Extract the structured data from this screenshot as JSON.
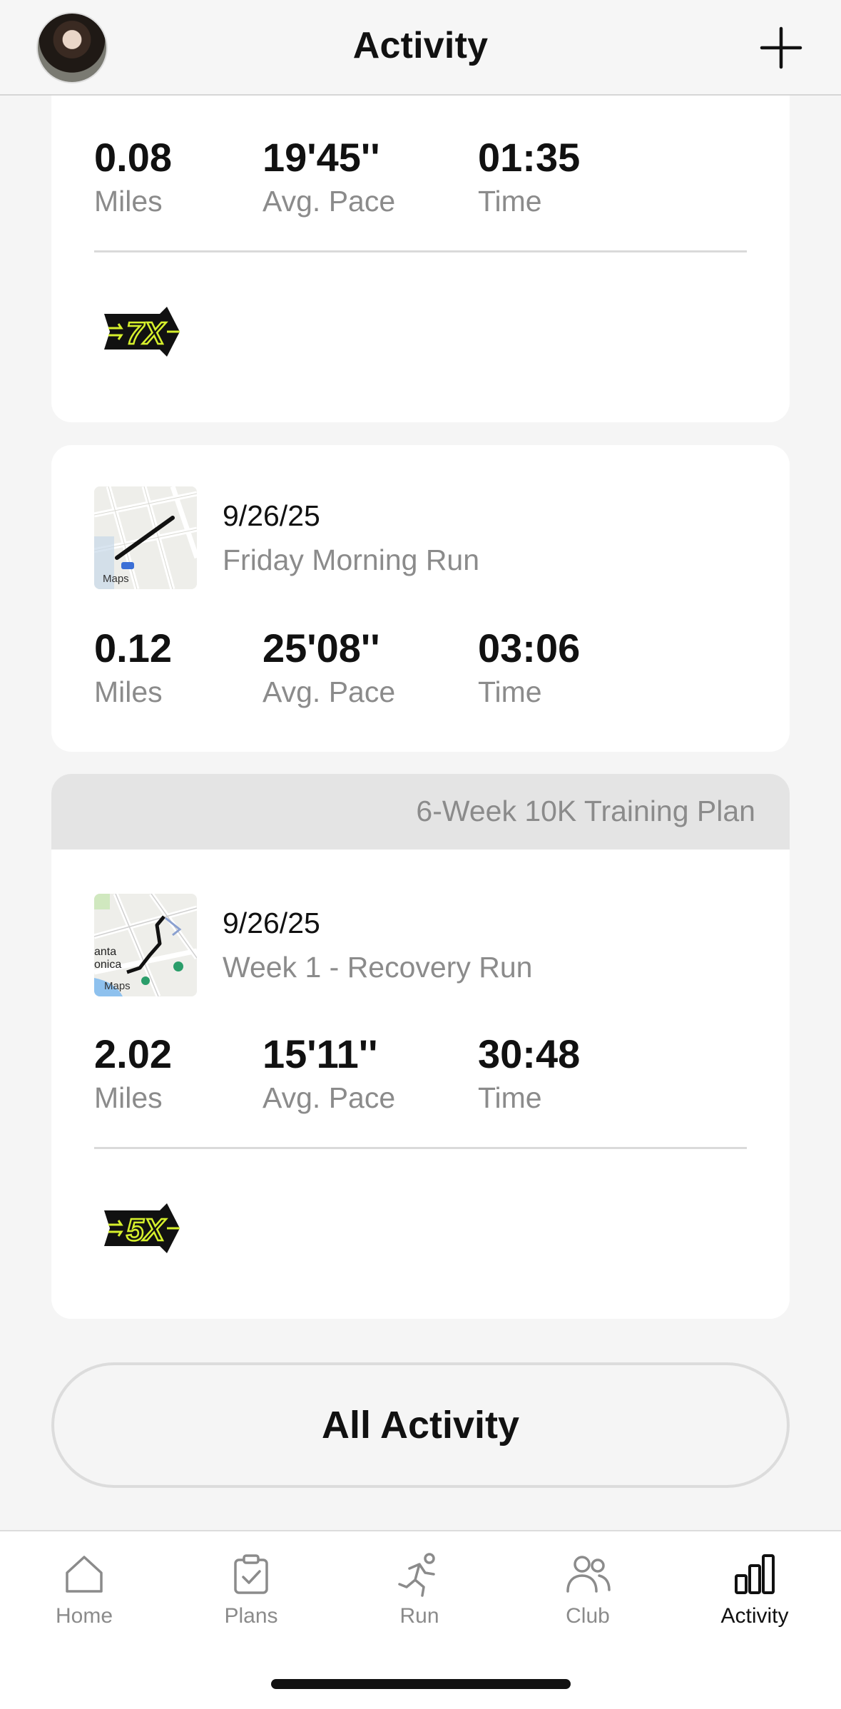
{
  "header": {
    "title": "Activity"
  },
  "runs": [
    {
      "stats": [
        {
          "value": "0.08",
          "label": "Miles"
        },
        {
          "value": "19'45''",
          "label": "Avg. Pace"
        },
        {
          "value": "01:35",
          "label": "Time"
        }
      ],
      "badge": "7X"
    },
    {
      "date": "9/26/25",
      "name": "Friday Morning Run",
      "map_label": "Maps",
      "stats": [
        {
          "value": "0.12",
          "label": "Miles"
        },
        {
          "value": "25'08''",
          "label": "Avg. Pace"
        },
        {
          "value": "03:06",
          "label": "Time"
        }
      ]
    },
    {
      "plan": "6-Week 10K Training Plan",
      "date": "9/26/25",
      "name": "Week 1 - Recovery Run",
      "map_label": "Maps",
      "stats": [
        {
          "value": "2.02",
          "label": "Miles"
        },
        {
          "value": "15'11''",
          "label": "Avg. Pace"
        },
        {
          "value": "30:48",
          "label": "Time"
        }
      ],
      "badge": "5X"
    }
  ],
  "all_activity_label": "All Activity",
  "tabs": [
    {
      "label": "Home",
      "icon": "home-icon"
    },
    {
      "label": "Plans",
      "icon": "clipboard-check-icon"
    },
    {
      "label": "Run",
      "icon": "runner-icon"
    },
    {
      "label": "Club",
      "icon": "people-icon"
    },
    {
      "label": "Activity",
      "icon": "bar-chart-icon",
      "active": true
    }
  ],
  "colors": {
    "badge_accent": "#d6f02c",
    "muted_text": "#8b8b8b"
  }
}
